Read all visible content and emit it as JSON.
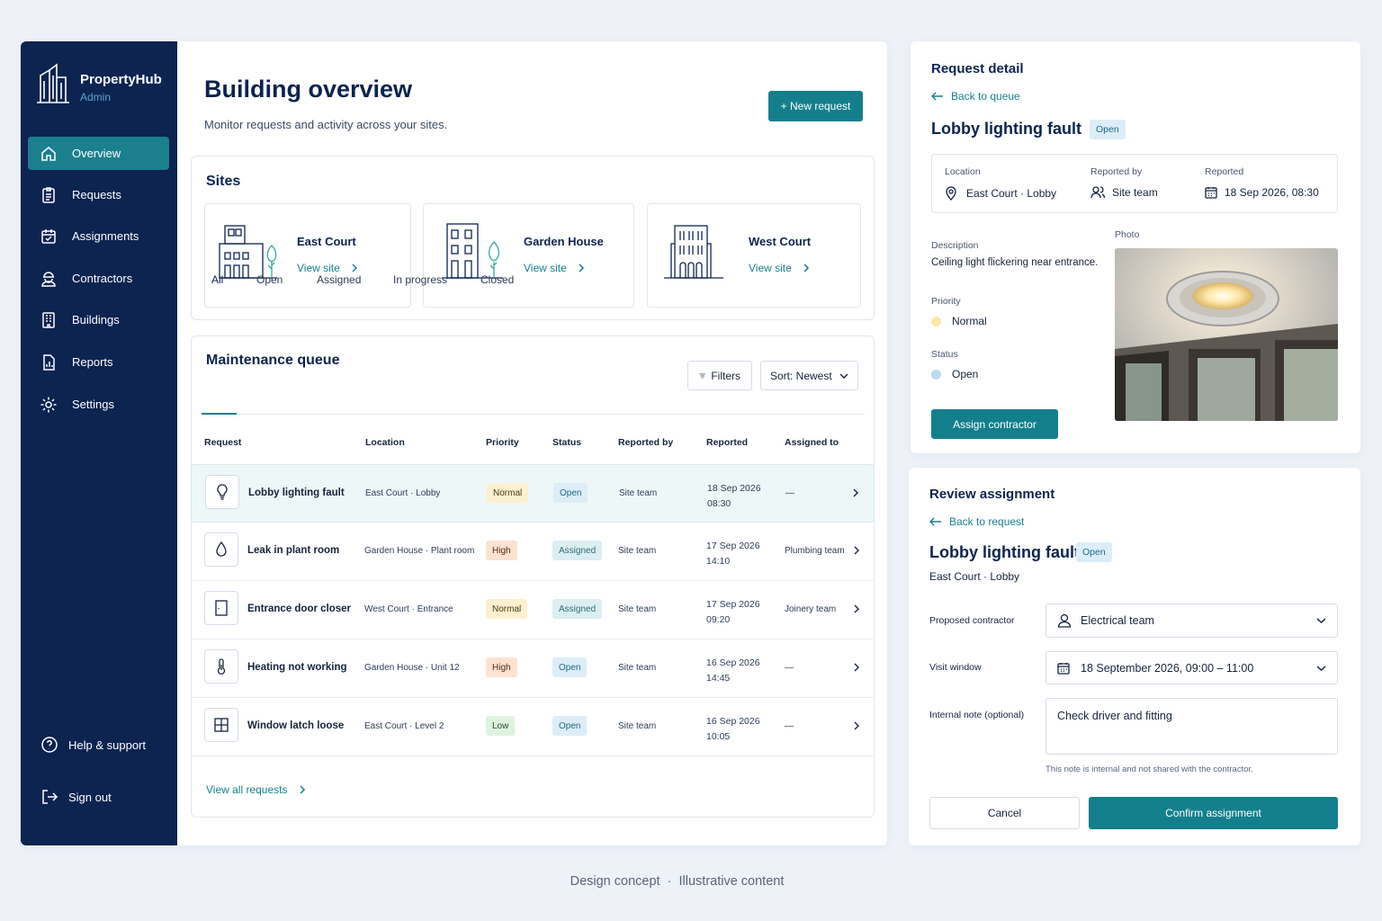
{
  "brand": {
    "name": "PropertyHub",
    "role": "Admin"
  },
  "nav": {
    "items": [
      {
        "label": "Overview",
        "icon": "home-icon"
      },
      {
        "label": "Requests",
        "icon": "clipboard-icon"
      },
      {
        "label": "Assignments",
        "icon": "calendar-check-icon"
      },
      {
        "label": "Contractors",
        "icon": "worker-icon"
      },
      {
        "label": "Buildings",
        "icon": "building-icon"
      },
      {
        "label": "Reports",
        "icon": "report-icon"
      },
      {
        "label": "Settings",
        "icon": "gear-icon"
      }
    ],
    "help": "Help & support",
    "signout": "Sign out"
  },
  "header": {
    "title": "Building overview",
    "subtitle": "Monitor requests and activity across your sites.",
    "new_request": "+ New request"
  },
  "sites": {
    "title": "Sites",
    "items": [
      {
        "name": "East Court",
        "link": "View site"
      },
      {
        "name": "Garden House",
        "link": "View site"
      },
      {
        "name": "West Court",
        "link": "View site"
      }
    ]
  },
  "queue": {
    "title": "Maintenance queue",
    "filters": "Filters",
    "sort": "Sort: Newest",
    "tabs": [
      "All",
      "Open",
      "Assigned",
      "In progress",
      "Closed"
    ],
    "columns": [
      "Request",
      "Location",
      "Priority",
      "Status",
      "Reported by",
      "Reported",
      "Assigned to"
    ],
    "rows": [
      {
        "title": "Lobby lighting fault",
        "location": "East Court · Lobby",
        "priority": "Normal",
        "status": "Open",
        "reported_by": "Site team",
        "date": "18 Sep 2026",
        "time": "08:30",
        "assigned": "—",
        "icon": "lightbulb-icon"
      },
      {
        "title": "Leak in plant room",
        "location": "Garden House · Plant room",
        "priority": "High",
        "status": "Assigned",
        "reported_by": "Site team",
        "date": "17 Sep 2026",
        "time": "14:10",
        "assigned": "Plumbing team",
        "icon": "water-drop-icon"
      },
      {
        "title": "Entrance door closer",
        "location": "West Court · Entrance",
        "priority": "Normal",
        "status": "Assigned",
        "reported_by": "Site team",
        "date": "17 Sep 2026",
        "time": "09:20",
        "assigned": "Joinery team",
        "icon": "door-icon"
      },
      {
        "title": "Heating not working",
        "location": "Garden House · Unit 12",
        "priority": "High",
        "status": "Open",
        "reported_by": "Site team",
        "date": "16 Sep 2026",
        "time": "14:45",
        "assigned": "—",
        "icon": "thermometer-icon"
      },
      {
        "title": "Window latch loose",
        "location": "East Court · Level 2",
        "priority": "Low",
        "status": "Open",
        "reported_by": "Site team",
        "date": "16 Sep 2026",
        "time": "10:05",
        "assigned": "—",
        "icon": "window-icon"
      }
    ],
    "view_all": "View all requests"
  },
  "detail": {
    "heading": "Request detail",
    "back": "Back to queue",
    "title": "Lobby lighting fault",
    "status": "Open",
    "location_label": "Location",
    "location": "East Court · Lobby",
    "reported_by_label": "Reported by",
    "reported_by": "Site team",
    "reported_label": "Reported",
    "reported": "18 Sep 2026, 08:30",
    "description_label": "Description",
    "description": "Ceiling light flickering near entrance.",
    "priority_label": "Priority",
    "priority": "Normal",
    "status_label": "Status",
    "status_value": "Open",
    "photo_label": "Photo",
    "assign": "Assign contractor",
    "colors": {
      "priority_dot": "#fbe9a8",
      "status_dot": "#b9dcf4"
    }
  },
  "review": {
    "heading": "Review assignment",
    "back": "Back to request",
    "title": "Lobby lighting fault",
    "status": "Open",
    "location": "East Court · Lobby",
    "contractor_label": "Proposed contractor",
    "contractor": "Electrical team",
    "window_label": "Visit window",
    "window": "18 September 2026, 09:00 – 11:00",
    "note_label": "Internal note (optional)",
    "note": "Check driver and fitting",
    "hint": "This note is internal and not shared with the contractor.",
    "cancel": "Cancel",
    "confirm": "Confirm assignment"
  },
  "footer": "Design concept  ·  Illustrative content",
  "colors": {
    "navy": "#0d2350",
    "teal": "#147f8c",
    "link": "#177f8e"
  }
}
